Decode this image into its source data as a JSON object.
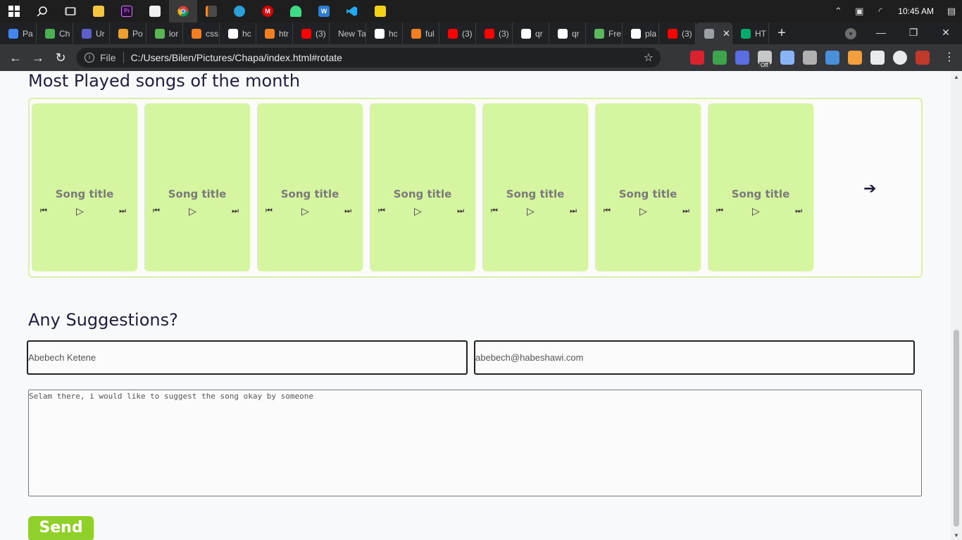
{
  "taskbar": {
    "time": "10:45 AM",
    "apps": [
      {
        "icon": "windows-start-icon",
        "color": "#ffffff"
      },
      {
        "icon": "search-icon",
        "color": "#ffffff"
      },
      {
        "icon": "task-view-icon",
        "color": "#ffffff"
      },
      {
        "icon": "file-explorer-icon",
        "color": "#f5c542"
      },
      {
        "icon": "premiere-pro-icon",
        "color": "#2a0a3a"
      },
      {
        "icon": "paint-icon",
        "color": "#f0f0f0"
      },
      {
        "icon": "chrome-icon",
        "color": "#e8b530"
      },
      {
        "icon": "sublime-icon",
        "color": "#f08a2a"
      },
      {
        "icon": "telegram-icon",
        "color": "#2aa0d8"
      },
      {
        "icon": "mega-icon",
        "color": "#d90007"
      },
      {
        "icon": "android-icon",
        "color": "#3ddc84"
      },
      {
        "icon": "word-icon",
        "color": "#2b7cd3"
      },
      {
        "icon": "vscode-icon",
        "color": "#23a9f2"
      },
      {
        "icon": "player-icon",
        "color": "#f4d21a"
      }
    ]
  },
  "tabs": [
    {
      "label": "Pa",
      "icon": "docs-icon",
      "color": "#4285f4"
    },
    {
      "label": "Ch",
      "icon": "chain-icon",
      "color": "#4caf50"
    },
    {
      "label": "Ur",
      "icon": "q-icon",
      "color": "#5b5fc7"
    },
    {
      "label": "Po",
      "icon": "ai-icon",
      "color": "#f0a030"
    },
    {
      "label": "lor",
      "icon": "star-icon",
      "color": "#5ab552"
    },
    {
      "label": "css",
      "icon": "stackoverflow-icon",
      "color": "#f48024"
    },
    {
      "label": "hc",
      "icon": "google-icon",
      "color": "#ffffff"
    },
    {
      "label": "htr",
      "icon": "stackoverflow-icon",
      "color": "#f48024"
    },
    {
      "label": "(3)",
      "icon": "youtube-icon",
      "color": "#ff0000"
    },
    {
      "label": "New Ta",
      "icon": "",
      "color": ""
    },
    {
      "label": "hc",
      "icon": "google-icon",
      "color": "#ffffff"
    },
    {
      "label": "ful",
      "icon": "stackoverflow-icon",
      "color": "#f48024"
    },
    {
      "label": "(3)",
      "icon": "youtube-icon",
      "color": "#ff0000"
    },
    {
      "label": "(3)",
      "icon": "youtube-icon",
      "color": "#ff0000"
    },
    {
      "label": "qr",
      "icon": "google-icon",
      "color": "#ffffff"
    },
    {
      "label": "qr",
      "icon": "google-icon",
      "color": "#ffffff"
    },
    {
      "label": "Fre",
      "icon": "leaf-icon",
      "color": "#5cb85c"
    },
    {
      "label": "pla",
      "icon": "google-icon",
      "color": "#ffffff"
    },
    {
      "label": "(3)",
      "icon": "youtube-icon",
      "color": "#ff0000"
    },
    {
      "label": "",
      "icon": "globe-icon",
      "color": "#9aa0a6",
      "active": true
    },
    {
      "label": "HT",
      "icon": "w3-icon",
      "color": "#04aa6d"
    }
  ],
  "address": {
    "scheme_label": "File",
    "url": "C:/Users/Bilen/Pictures/Chapa/index.html#rotate"
  },
  "extensions": [
    "#d9232e",
    "#3fa34d",
    "#5b6ee1",
    "#c8c8c8",
    "#8ab4f8",
    "#b0b0b0",
    "#4a90d9",
    "#f2a03d",
    "#e8eaed",
    "#e8eaed",
    "#c0392b"
  ],
  "extension_badge": "Off",
  "page": {
    "section_title": "Most Played songs of the month",
    "songs": [
      {
        "title": "Song title"
      },
      {
        "title": "Song title"
      },
      {
        "title": "Song title"
      },
      {
        "title": "Song title"
      },
      {
        "title": "Song title"
      },
      {
        "title": "Song title"
      },
      {
        "title": "Song title"
      }
    ],
    "suggestions_title": "Any Suggestions?",
    "name_value": "Abebech Ketene",
    "email_value": "abebech@habeshawi.com",
    "message_value": "Selam there, i would like to suggest the song okay by someone",
    "send_label": "Send"
  },
  "colors": {
    "accent_green": "#8fd12a",
    "card_green": "#d6f5a0",
    "heading": "#1f1d3d"
  }
}
